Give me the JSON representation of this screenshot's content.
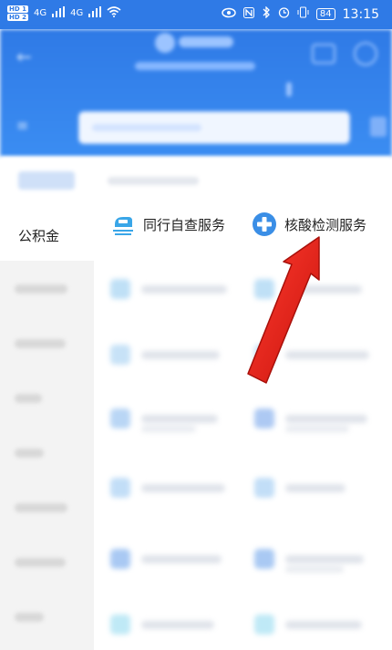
{
  "status_bar": {
    "sim_badges": [
      "HD 1",
      "HD 2"
    ],
    "network": [
      "4G",
      "4G"
    ],
    "battery": "84",
    "time": "13:15"
  },
  "sidebar": {
    "active_label": "公积金"
  },
  "services": [
    {
      "label": "同行自查服务",
      "icon": "train-check-icon"
    },
    {
      "label": "核酸检测服务",
      "icon": "medical-cross-icon"
    }
  ],
  "annotation": {
    "type": "red-arrow",
    "points_to": "核酸检测服务"
  }
}
